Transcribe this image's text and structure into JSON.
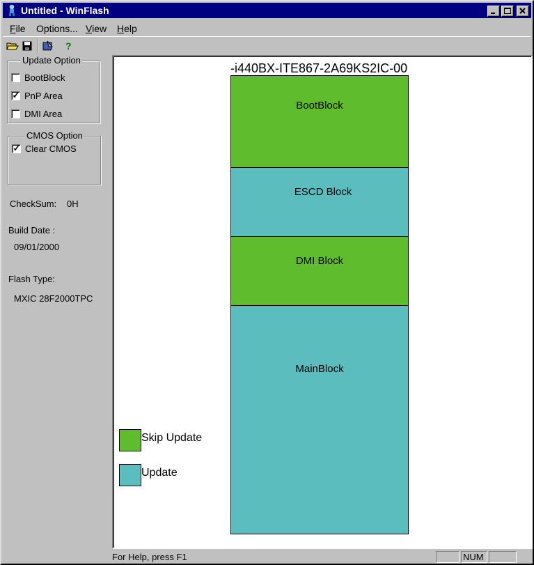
{
  "window": {
    "title": "Untitled - WinFlash",
    "controls": {
      "minimize": "minimize",
      "maximize": "maximize",
      "close": "close"
    }
  },
  "menu": {
    "items": [
      {
        "label": "File",
        "underline": "F",
        "rest": "ile"
      },
      {
        "label": "Options...",
        "underline": "",
        "rest": "Options..."
      },
      {
        "label": "View",
        "underline": "V",
        "rest": "iew"
      },
      {
        "label": "Help",
        "underline": "H",
        "rest": "elp"
      }
    ]
  },
  "toolbar": {
    "icons": [
      "open-folder-icon",
      "save-disk-icon",
      "flash-chip-icon",
      "help-icon"
    ]
  },
  "left_panel": {
    "update_option": {
      "title": "Update Option",
      "items": [
        {
          "label": "BootBlock",
          "checked": false
        },
        {
          "label": "PnP Area",
          "checked": true
        },
        {
          "label": "DMI Area",
          "checked": false
        }
      ]
    },
    "cmos_option": {
      "title": "CMOS Option",
      "items": [
        {
          "label": "Clear CMOS",
          "checked": true
        }
      ]
    },
    "checksum_label": "CheckSum:",
    "checksum_value": "0H",
    "build_date_label": "Build Date :",
    "build_date_value": "09/01/2000",
    "flash_type_label": "Flash Type:",
    "flash_type_value": "MXIC 28F2000TPC"
  },
  "flash_map": {
    "bios_id": "-i440BX-ITE867-2A69KS2IC-00",
    "blocks": [
      {
        "label": "BootBlock",
        "status": "skip"
      },
      {
        "label": "ESCD Block",
        "status": "update"
      },
      {
        "label": "DMI Block",
        "status": "skip"
      },
      {
        "label": "MainBlock",
        "status": "update"
      }
    ],
    "legend": [
      {
        "label": "Skip Update",
        "status": "skip"
      },
      {
        "label": "Update",
        "status": "update"
      }
    ],
    "colors": {
      "skip": "#5fbd2d",
      "update": "#5bbdbe"
    }
  },
  "status_bar": {
    "help_text": "For Help, press F1",
    "num_lock": "NUM"
  }
}
